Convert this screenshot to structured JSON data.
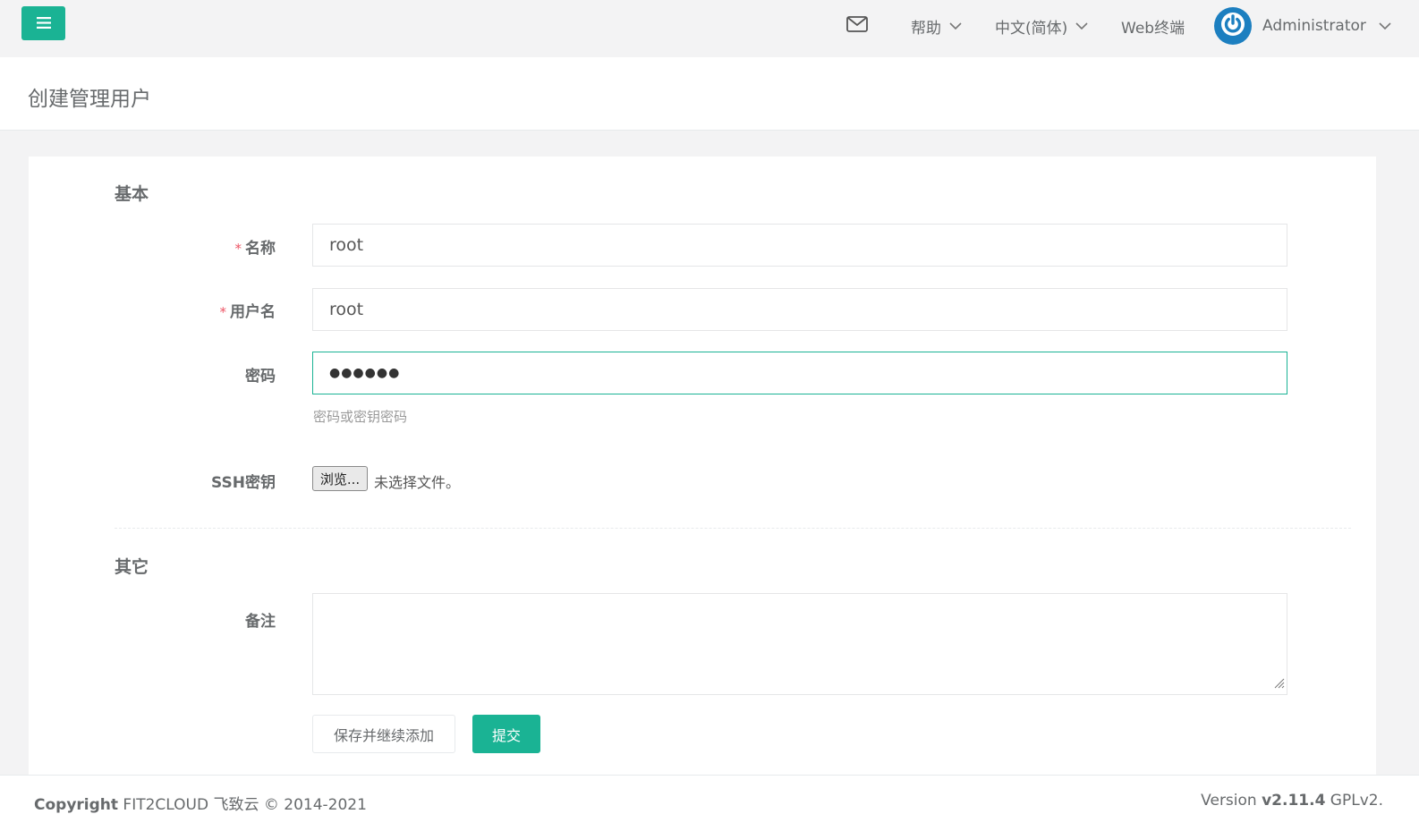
{
  "colors": {
    "accent": "#1ab394",
    "avatar": "#1c7fc0",
    "required": "#ed5565"
  },
  "topbar": {
    "menu_icon": "hamburger-icon",
    "mail_icon": "envelope-icon",
    "help_label": "帮助",
    "language_label": "中文(简体)",
    "web_terminal_label": "Web终端",
    "user_name": "Administrator"
  },
  "page": {
    "title": "创建管理用户"
  },
  "form": {
    "section_basic": "基本",
    "required_mark": "*",
    "name": {
      "label": "名称",
      "value": "root"
    },
    "username": {
      "label": "用户名",
      "value": "root"
    },
    "password": {
      "label": "密码",
      "masked_value": "●●●●●●",
      "help": "密码或密钥密码"
    },
    "ssh_key": {
      "label": "SSH密钥",
      "browse_label": "浏览...",
      "status": "未选择文件。"
    },
    "section_other": "其它",
    "comment": {
      "label": "备注",
      "value": ""
    },
    "save_continue_label": "保存并继续添加",
    "submit_label": "提交"
  },
  "footer": {
    "copyright_strong": "Copyright",
    "copyright_text": " FIT2CLOUD 飞致云 © 2014-2021",
    "version_prefix": "Version ",
    "version_number": "v2.11.4",
    "license": " GPLv2."
  }
}
